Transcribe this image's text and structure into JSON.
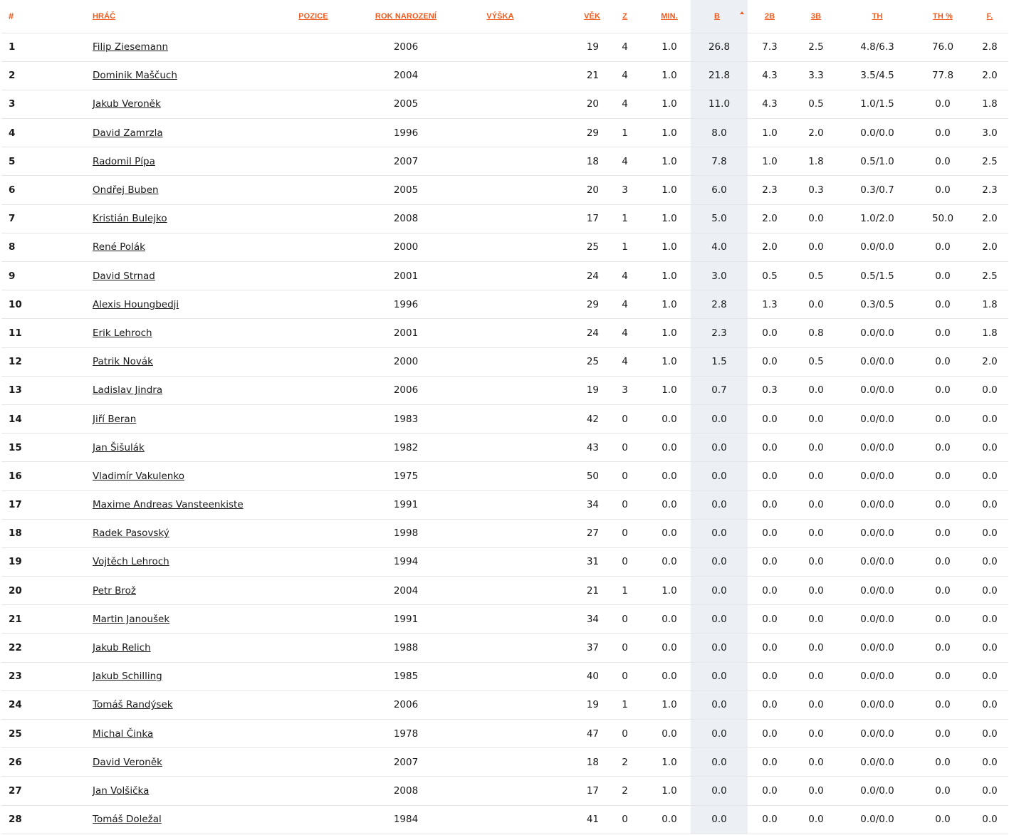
{
  "table": {
    "headers": {
      "rank": "#",
      "player": "HRÁČ",
      "position": "POZICE",
      "birth_year": "ROK NAROZENÍ",
      "height": "VÝŠKA",
      "age": "VĚK",
      "games": "Z",
      "minutes": "MIN.",
      "points": "B",
      "two_pt": "2B",
      "three_pt": "3B",
      "free_throws": "TH",
      "ft_pct": "TH %",
      "fouls": "F."
    },
    "sorted_column": "points",
    "sort_direction": "desc",
    "rows": [
      {
        "rank": "1",
        "name": "Filip Ziesemann",
        "position": "",
        "birth_year": "2006",
        "height": "",
        "age": "19",
        "games": "4",
        "minutes": "1.0",
        "points": "26.8",
        "two_pt": "7.3",
        "three_pt": "2.5",
        "ft": "4.8/6.3",
        "ft_pct": "76.0",
        "fouls": "2.8"
      },
      {
        "rank": "2",
        "name": "Dominik Maščuch",
        "position": "",
        "birth_year": "2004",
        "height": "",
        "age": "21",
        "games": "4",
        "minutes": "1.0",
        "points": "21.8",
        "two_pt": "4.3",
        "three_pt": "3.3",
        "ft": "3.5/4.5",
        "ft_pct": "77.8",
        "fouls": "2.0"
      },
      {
        "rank": "3",
        "name": "Jakub Veroněk",
        "position": "",
        "birth_year": "2005",
        "height": "",
        "age": "20",
        "games": "4",
        "minutes": "1.0",
        "points": "11.0",
        "two_pt": "4.3",
        "three_pt": "0.5",
        "ft": "1.0/1.5",
        "ft_pct": "0.0",
        "fouls": "1.8"
      },
      {
        "rank": "4",
        "name": "David Zamrzla",
        "position": "",
        "birth_year": "1996",
        "height": "",
        "age": "29",
        "games": "1",
        "minutes": "1.0",
        "points": "8.0",
        "two_pt": "1.0",
        "three_pt": "2.0",
        "ft": "0.0/0.0",
        "ft_pct": "0.0",
        "fouls": "3.0"
      },
      {
        "rank": "5",
        "name": "Radomil Pípa",
        "position": "",
        "birth_year": "2007",
        "height": "",
        "age": "18",
        "games": "4",
        "minutes": "1.0",
        "points": "7.8",
        "two_pt": "1.0",
        "three_pt": "1.8",
        "ft": "0.5/1.0",
        "ft_pct": "0.0",
        "fouls": "2.5"
      },
      {
        "rank": "6",
        "name": "Ondřej Buben",
        "position": "",
        "birth_year": "2005",
        "height": "",
        "age": "20",
        "games": "3",
        "minutes": "1.0",
        "points": "6.0",
        "two_pt": "2.3",
        "three_pt": "0.3",
        "ft": "0.3/0.7",
        "ft_pct": "0.0",
        "fouls": "2.3"
      },
      {
        "rank": "7",
        "name": "Kristián Bulejko",
        "position": "",
        "birth_year": "2008",
        "height": "",
        "age": "17",
        "games": "1",
        "minutes": "1.0",
        "points": "5.0",
        "two_pt": "2.0",
        "three_pt": "0.0",
        "ft": "1.0/2.0",
        "ft_pct": "50.0",
        "fouls": "2.0"
      },
      {
        "rank": "8",
        "name": "René Polák",
        "position": "",
        "birth_year": "2000",
        "height": "",
        "age": "25",
        "games": "1",
        "minutes": "1.0",
        "points": "4.0",
        "two_pt": "2.0",
        "three_pt": "0.0",
        "ft": "0.0/0.0",
        "ft_pct": "0.0",
        "fouls": "2.0"
      },
      {
        "rank": "9",
        "name": "David Strnad",
        "position": "",
        "birth_year": "2001",
        "height": "",
        "age": "24",
        "games": "4",
        "minutes": "1.0",
        "points": "3.0",
        "two_pt": "0.5",
        "three_pt": "0.5",
        "ft": "0.5/1.5",
        "ft_pct": "0.0",
        "fouls": "2.5"
      },
      {
        "rank": "10",
        "name": "Alexis Houngbedji",
        "position": "",
        "birth_year": "1996",
        "height": "",
        "age": "29",
        "games": "4",
        "minutes": "1.0",
        "points": "2.8",
        "two_pt": "1.3",
        "three_pt": "0.0",
        "ft": "0.3/0.5",
        "ft_pct": "0.0",
        "fouls": "1.8"
      },
      {
        "rank": "11",
        "name": "Erik Lehroch",
        "position": "",
        "birth_year": "2001",
        "height": "",
        "age": "24",
        "games": "4",
        "minutes": "1.0",
        "points": "2.3",
        "two_pt": "0.0",
        "three_pt": "0.8",
        "ft": "0.0/0.0",
        "ft_pct": "0.0",
        "fouls": "1.8"
      },
      {
        "rank": "12",
        "name": "Patrik Novák",
        "position": "",
        "birth_year": "2000",
        "height": "",
        "age": "25",
        "games": "4",
        "minutes": "1.0",
        "points": "1.5",
        "two_pt": "0.0",
        "three_pt": "0.5",
        "ft": "0.0/0.0",
        "ft_pct": "0.0",
        "fouls": "2.0"
      },
      {
        "rank": "13",
        "name": "Ladislav Jindra",
        "position": "",
        "birth_year": "2006",
        "height": "",
        "age": "19",
        "games": "3",
        "minutes": "1.0",
        "points": "0.7",
        "two_pt": "0.3",
        "three_pt": "0.0",
        "ft": "0.0/0.0",
        "ft_pct": "0.0",
        "fouls": "0.0"
      },
      {
        "rank": "14",
        "name": "Jiří Beran",
        "position": "",
        "birth_year": "1983",
        "height": "",
        "age": "42",
        "games": "0",
        "minutes": "0.0",
        "points": "0.0",
        "two_pt": "0.0",
        "three_pt": "0.0",
        "ft": "0.0/0.0",
        "ft_pct": "0.0",
        "fouls": "0.0"
      },
      {
        "rank": "15",
        "name": "Jan Šišulák",
        "position": "",
        "birth_year": "1982",
        "height": "",
        "age": "43",
        "games": "0",
        "minutes": "0.0",
        "points": "0.0",
        "two_pt": "0.0",
        "three_pt": "0.0",
        "ft": "0.0/0.0",
        "ft_pct": "0.0",
        "fouls": "0.0"
      },
      {
        "rank": "16",
        "name": "Vladimír Vakulenko",
        "position": "",
        "birth_year": "1975",
        "height": "",
        "age": "50",
        "games": "0",
        "minutes": "0.0",
        "points": "0.0",
        "two_pt": "0.0",
        "three_pt": "0.0",
        "ft": "0.0/0.0",
        "ft_pct": "0.0",
        "fouls": "0.0"
      },
      {
        "rank": "17",
        "name": "Maxime Andreas Vansteenkiste",
        "position": "",
        "birth_year": "1991",
        "height": "",
        "age": "34",
        "games": "0",
        "minutes": "0.0",
        "points": "0.0",
        "two_pt": "0.0",
        "three_pt": "0.0",
        "ft": "0.0/0.0",
        "ft_pct": "0.0",
        "fouls": "0.0"
      },
      {
        "rank": "18",
        "name": "Radek Pasovský",
        "position": "",
        "birth_year": "1998",
        "height": "",
        "age": "27",
        "games": "0",
        "minutes": "0.0",
        "points": "0.0",
        "two_pt": "0.0",
        "three_pt": "0.0",
        "ft": "0.0/0.0",
        "ft_pct": "0.0",
        "fouls": "0.0"
      },
      {
        "rank": "19",
        "name": "Vojtěch Lehroch",
        "position": "",
        "birth_year": "1994",
        "height": "",
        "age": "31",
        "games": "0",
        "minutes": "0.0",
        "points": "0.0",
        "two_pt": "0.0",
        "three_pt": "0.0",
        "ft": "0.0/0.0",
        "ft_pct": "0.0",
        "fouls": "0.0"
      },
      {
        "rank": "20",
        "name": "Petr Brož",
        "position": "",
        "birth_year": "2004",
        "height": "",
        "age": "21",
        "games": "1",
        "minutes": "1.0",
        "points": "0.0",
        "two_pt": "0.0",
        "three_pt": "0.0",
        "ft": "0.0/0.0",
        "ft_pct": "0.0",
        "fouls": "0.0"
      },
      {
        "rank": "21",
        "name": "Martin Janoušek",
        "position": "",
        "birth_year": "1991",
        "height": "",
        "age": "34",
        "games": "0",
        "minutes": "0.0",
        "points": "0.0",
        "two_pt": "0.0",
        "three_pt": "0.0",
        "ft": "0.0/0.0",
        "ft_pct": "0.0",
        "fouls": "0.0"
      },
      {
        "rank": "22",
        "name": "Jakub Relich",
        "position": "",
        "birth_year": "1988",
        "height": "",
        "age": "37",
        "games": "0",
        "minutes": "0.0",
        "points": "0.0",
        "two_pt": "0.0",
        "three_pt": "0.0",
        "ft": "0.0/0.0",
        "ft_pct": "0.0",
        "fouls": "0.0"
      },
      {
        "rank": "23",
        "name": "Jakub Schilling",
        "position": "",
        "birth_year": "1985",
        "height": "",
        "age": "40",
        "games": "0",
        "minutes": "0.0",
        "points": "0.0",
        "two_pt": "0.0",
        "three_pt": "0.0",
        "ft": "0.0/0.0",
        "ft_pct": "0.0",
        "fouls": "0.0"
      },
      {
        "rank": "24",
        "name": "Tomáš Randýsek",
        "position": "",
        "birth_year": "2006",
        "height": "",
        "age": "19",
        "games": "1",
        "minutes": "1.0",
        "points": "0.0",
        "two_pt": "0.0",
        "three_pt": "0.0",
        "ft": "0.0/0.0",
        "ft_pct": "0.0",
        "fouls": "0.0"
      },
      {
        "rank": "25",
        "name": "Michal Činka",
        "position": "",
        "birth_year": "1978",
        "height": "",
        "age": "47",
        "games": "0",
        "minutes": "0.0",
        "points": "0.0",
        "two_pt": "0.0",
        "three_pt": "0.0",
        "ft": "0.0/0.0",
        "ft_pct": "0.0",
        "fouls": "0.0"
      },
      {
        "rank": "26",
        "name": "David Veroněk",
        "position": "",
        "birth_year": "2007",
        "height": "",
        "age": "18",
        "games": "2",
        "minutes": "1.0",
        "points": "0.0",
        "two_pt": "0.0",
        "three_pt": "0.0",
        "ft": "0.0/0.0",
        "ft_pct": "0.0",
        "fouls": "0.0"
      },
      {
        "rank": "27",
        "name": "Jan Volšička",
        "position": "",
        "birth_year": "2008",
        "height": "",
        "age": "17",
        "games": "2",
        "minutes": "1.0",
        "points": "0.0",
        "two_pt": "0.0",
        "three_pt": "0.0",
        "ft": "0.0/0.0",
        "ft_pct": "0.0",
        "fouls": "0.0"
      },
      {
        "rank": "28",
        "name": "Tomáš Doležal",
        "position": "",
        "birth_year": "1984",
        "height": "",
        "age": "41",
        "games": "0",
        "minutes": "0.0",
        "points": "0.0",
        "two_pt": "0.0",
        "three_pt": "0.0",
        "ft": "0.0/0.0",
        "ft_pct": "0.0",
        "fouls": "0.0"
      }
    ]
  },
  "colors": {
    "header_accent": "#ef5a1c",
    "sorted_column_bg": "#eceff3",
    "row_border": "#e6e6e6",
    "text": "#1a1a1a"
  },
  "icons": {
    "sort_indicator": "sort-ascending-arrow-icon"
  }
}
